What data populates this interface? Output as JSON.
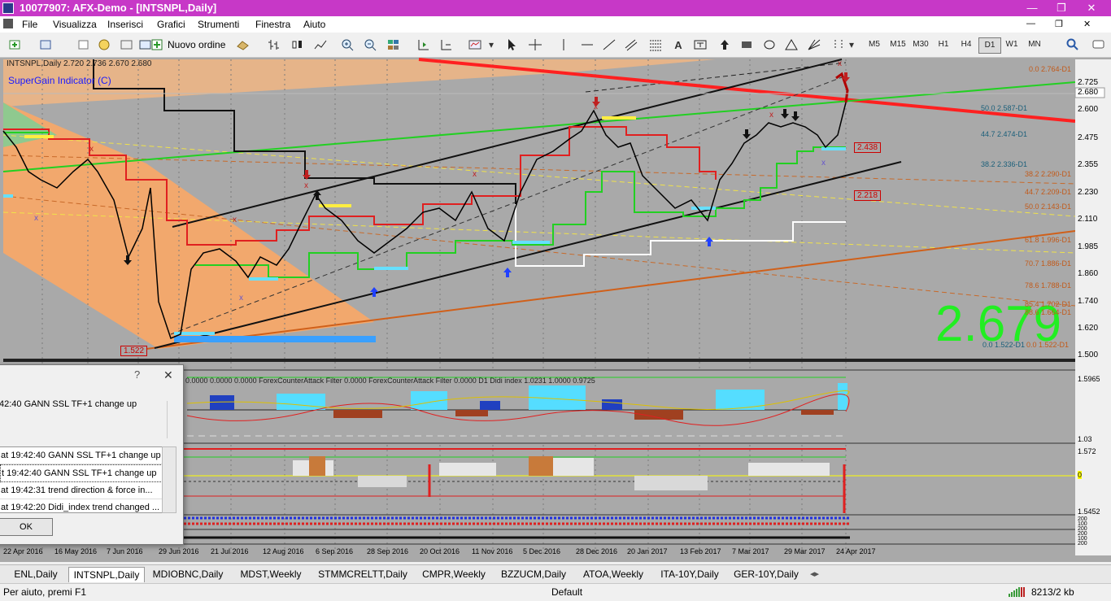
{
  "window": {
    "title": "10077907: AFX-Demo - [INTSNPL,Daily]"
  },
  "menu": [
    "File",
    "Visualizza",
    "Inserisci",
    "Grafici",
    "Strumenti",
    "Finestra",
    "Aiuto"
  ],
  "toolbar": {
    "new_order": "Nuovo ordine",
    "draw_text": "A",
    "timeframes": [
      "M5",
      "M15",
      "M30",
      "H1",
      "H4",
      "D1",
      "W1",
      "MN"
    ],
    "active_timeframe": "D1"
  },
  "chart": {
    "symbol_line": "INTSNPL,Daily  2.720 2.736 2.670 2.680",
    "indicator_name": "SuperGain Indicator (C)",
    "big_price": "2.679",
    "price_scale": [
      "2.725",
      "2.600",
      "2.475",
      "2.355",
      "2.230",
      "2.110",
      "1.985",
      "1.860",
      "1.740",
      "1.620",
      "1.500"
    ],
    "current_price_badge": "2.680",
    "fib_labels": [
      "0.0 2.764-D1",
      "50.0 2.587-D1",
      "44.7 2.474-D1",
      "38.2 2.336-D1",
      "38.2 2.290-D1",
      "44.7 2.209-D1",
      "50.0 2.143-D1",
      "61.8 1.996-D1",
      "70.7 1.886-D1",
      "78.6 1.788-D1",
      "85.4 1.702-D1",
      "88.6 1.664-D1",
      "0.0 1.522-D1",
      "0.0 1.522-D1"
    ],
    "red_boxes": [
      "2.438",
      "2.218",
      "1.522"
    ],
    "sub1_label": "0.0000 0.0000 0.0000  ForexCounterAttack Filter 0.0000  ForexCounterAttack Filter 0.0000  D1 Didi index 1.0231 1.0000 0.9725",
    "sub1_scale": [
      "1.5965",
      "1.03"
    ],
    "sub2_scale": [
      "1.572",
      "0",
      "1.5452"
    ],
    "sub3_scale": [
      "200",
      "100",
      "200"
    ],
    "sub4_scale": [
      "200",
      "100",
      "200"
    ],
    "dates": [
      "22 Apr 2016",
      "16 May 2016",
      "7 Jun 2016",
      "29 Jun 2016",
      "21 Jul 2016",
      "12 Aug 2016",
      "6 Sep 2016",
      "28 Sep 2016",
      "20 Oct 2016",
      "11 Nov 2016",
      "5 Dec 2016",
      "28 Dec 2016",
      "20 Jan 2017",
      "13 Feb 2017",
      "7 Mar 2017",
      "29 Mar 2017",
      "24 Apr 2017"
    ]
  },
  "dialog": {
    "help": "?",
    "close": "✕",
    "message": "42:40 GANN SSL TF+1 change up",
    "rows": [
      "at 19:42:40 GANN SSL TF+1 change up",
      "t 19:42:40 GANN SSL TF+1 change up",
      "at 19:42:31 trend direction & force in...",
      "at 19:42:20 Didi_index trend changed ..."
    ],
    "ok": "OK"
  },
  "tabs": [
    "ENL,Daily",
    "INTSNPL,Daily",
    "MDIOBNC,Daily",
    "MDST,Weekly",
    "STMMCRELTT,Daily",
    "CMPR,Weekly",
    "BZZUCM,Daily",
    "ATOA,Weekly",
    "ITA-10Y,Daily",
    "GER-10Y,Daily"
  ],
  "active_tab": "INTSNPL,Daily",
  "status": {
    "help": "Per aiuto, premi F1",
    "profile": "Default",
    "traffic": "8213/2 kb"
  }
}
